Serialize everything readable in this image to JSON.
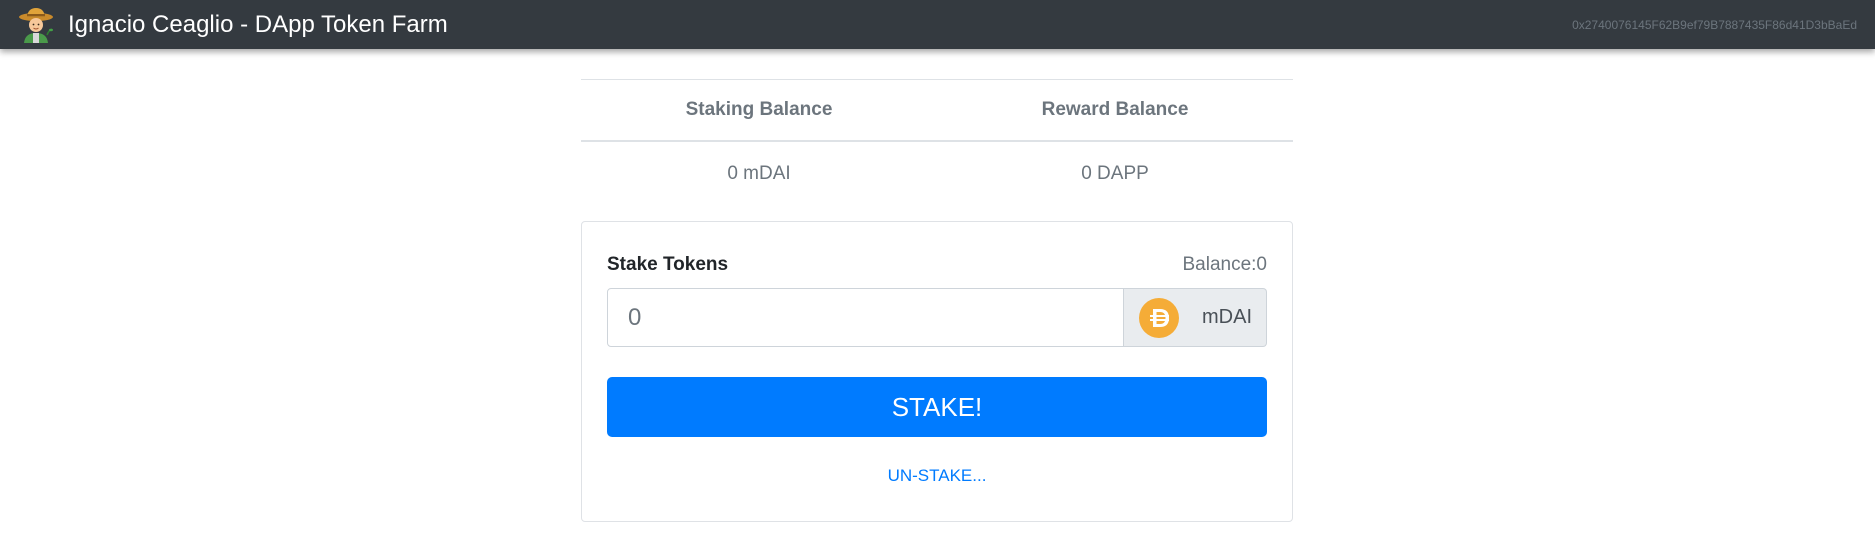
{
  "navbar": {
    "icon": "farmer-icon",
    "title": "Ignacio Ceaglio - DApp Token Farm",
    "account": "0x2740076145F62B9ef79B7887435F86d41D3bBaEd"
  },
  "balances": {
    "headers": [
      "Staking Balance",
      "Reward Balance"
    ],
    "values": [
      "0 mDAI",
      "0 DAPP"
    ]
  },
  "stake_form": {
    "label": "Stake Tokens",
    "balance_text": "Balance:0",
    "amount_placeholder": "0",
    "token_icon": "dai-coin-icon",
    "token_name": "mDAI",
    "stake_button": "STAKE!",
    "unstake_link": "UN-STAKE..."
  },
  "colors": {
    "navbar": "#343a40",
    "primary": "#007bff",
    "dai_coin": "#f5ac37"
  }
}
